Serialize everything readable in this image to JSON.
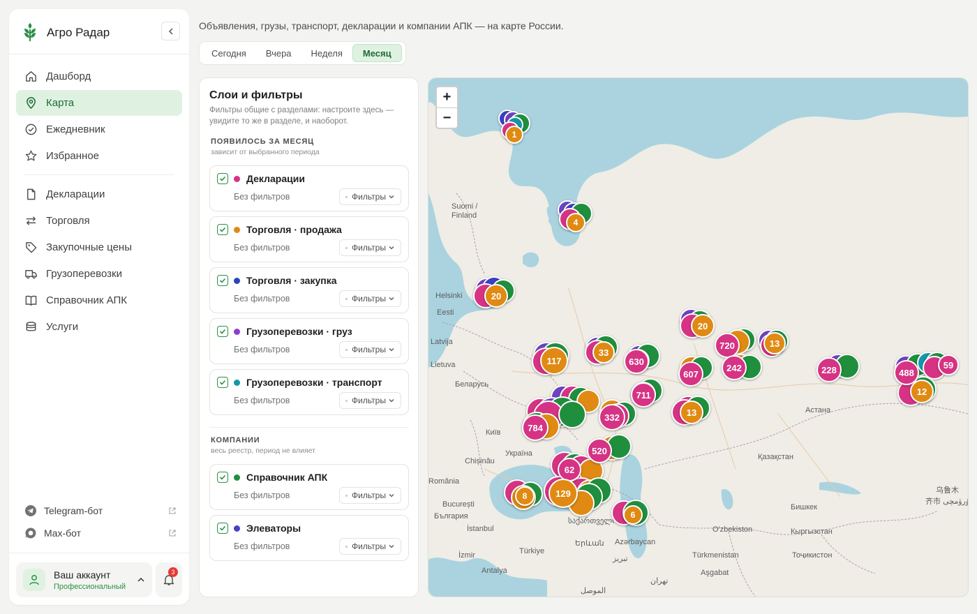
{
  "brand": {
    "name": "Агро Радар"
  },
  "nav": {
    "primary": [
      {
        "label": "Дашборд",
        "icon": "home-icon"
      },
      {
        "label": "Карта",
        "icon": "map-pin-icon",
        "active": true
      },
      {
        "label": "Ежедневник",
        "icon": "check-circle-icon"
      },
      {
        "label": "Избранное",
        "icon": "star-icon"
      }
    ],
    "secondary": [
      {
        "label": "Декларации",
        "icon": "document-icon"
      },
      {
        "label": "Торговля",
        "icon": "arrows-swap-icon"
      },
      {
        "label": "Закупочные цены",
        "icon": "tag-icon"
      },
      {
        "label": "Грузоперевозки",
        "icon": "truck-icon"
      },
      {
        "label": "Справочник АПК",
        "icon": "book-icon"
      },
      {
        "label": "Услуги",
        "icon": "box-icon"
      }
    ]
  },
  "bots": [
    {
      "label": "Telegram-бот",
      "icon": "telegram-icon"
    },
    {
      "label": "Max-бот",
      "icon": "chat-icon"
    }
  ],
  "account": {
    "name": "Ваш аккаунт",
    "plan": "Профессиональный",
    "notifications": "3"
  },
  "header": {
    "subtitle": "Объявления, грузы, транспорт, декларации и компании АПК — на карте России.",
    "periods": [
      "Сегодня",
      "Вчера",
      "Неделя",
      "Месяц"
    ],
    "active_period": "Месяц"
  },
  "filters": {
    "title": "Слои и фильтры",
    "description": "Фильтры общие с разделами: настроите здесь — увидите то же в разделе, и наоборот.",
    "sections": [
      {
        "title": "ПОЯВИЛОСЬ ЗА МЕСЯЦ",
        "subtitle": "зависит от выбранного периода",
        "layers": [
          {
            "name": "Декларации",
            "color": "#d63384",
            "status": "Без фильтров",
            "filter_label": "Фильтры"
          },
          {
            "name": "Торговля · продажа",
            "color": "#e08a13",
            "status": "Без фильтров",
            "filter_label": "Фильтры"
          },
          {
            "name": "Торговля · закупка",
            "color": "#2a45b8",
            "status": "Без фильтров",
            "filter_label": "Фильтры"
          },
          {
            "name": "Грузоперевозки · груз",
            "color": "#8a3fd1",
            "status": "Без фильтров",
            "filter_label": "Фильтры"
          },
          {
            "name": "Грузоперевозки · транспорт",
            "color": "#1597a8",
            "status": "Без фильтров",
            "filter_label": "Фильтры"
          }
        ]
      },
      {
        "title": "КОМПАНИИ",
        "subtitle": "весь реестр, период не влияет",
        "layers": [
          {
            "name": "Справочник АПК",
            "color": "#1f8f3d",
            "status": "Без фильтров",
            "filter_label": "Фильтры"
          },
          {
            "name": "Элеваторы",
            "color": "#4a3fc9",
            "status": "Без фильтров",
            "filter_label": "Фильтры"
          }
        ]
      }
    ]
  },
  "map": {
    "zoom_in": "+",
    "zoom_out": "−",
    "places": [
      "Suomi /",
      "Finland",
      "Helsinki",
      "Eesti",
      "Latvija",
      "Lietuva",
      "Беларусь",
      "Київ",
      "Україна",
      "Chișinău",
      "România",
      "București",
      "България",
      "İstanbul",
      "Türkiye",
      "İzmir",
      "Antalya",
      "საქართველო",
      "Երևան",
      "Azərbaycan",
      "تبریز",
      "تهران",
      "الموصل",
      "Türkmenistan",
      "Aşgabat",
      "O'zbekiston",
      "Тоҷикистон",
      "Бишкек",
      "Кыргызстан",
      "Қазақстан",
      "Астана",
      "乌鲁木",
      "齐市 ئۈرۈمچى"
    ],
    "cluster_labels": [
      "1",
      "4",
      "20",
      "117",
      "33",
      "630",
      "20",
      "720",
      "13",
      "242",
      "607",
      "228",
      "488",
      "59",
      "12",
      "711",
      "13",
      "332",
      "784",
      "520",
      "62",
      "129",
      "8",
      "6"
    ]
  }
}
